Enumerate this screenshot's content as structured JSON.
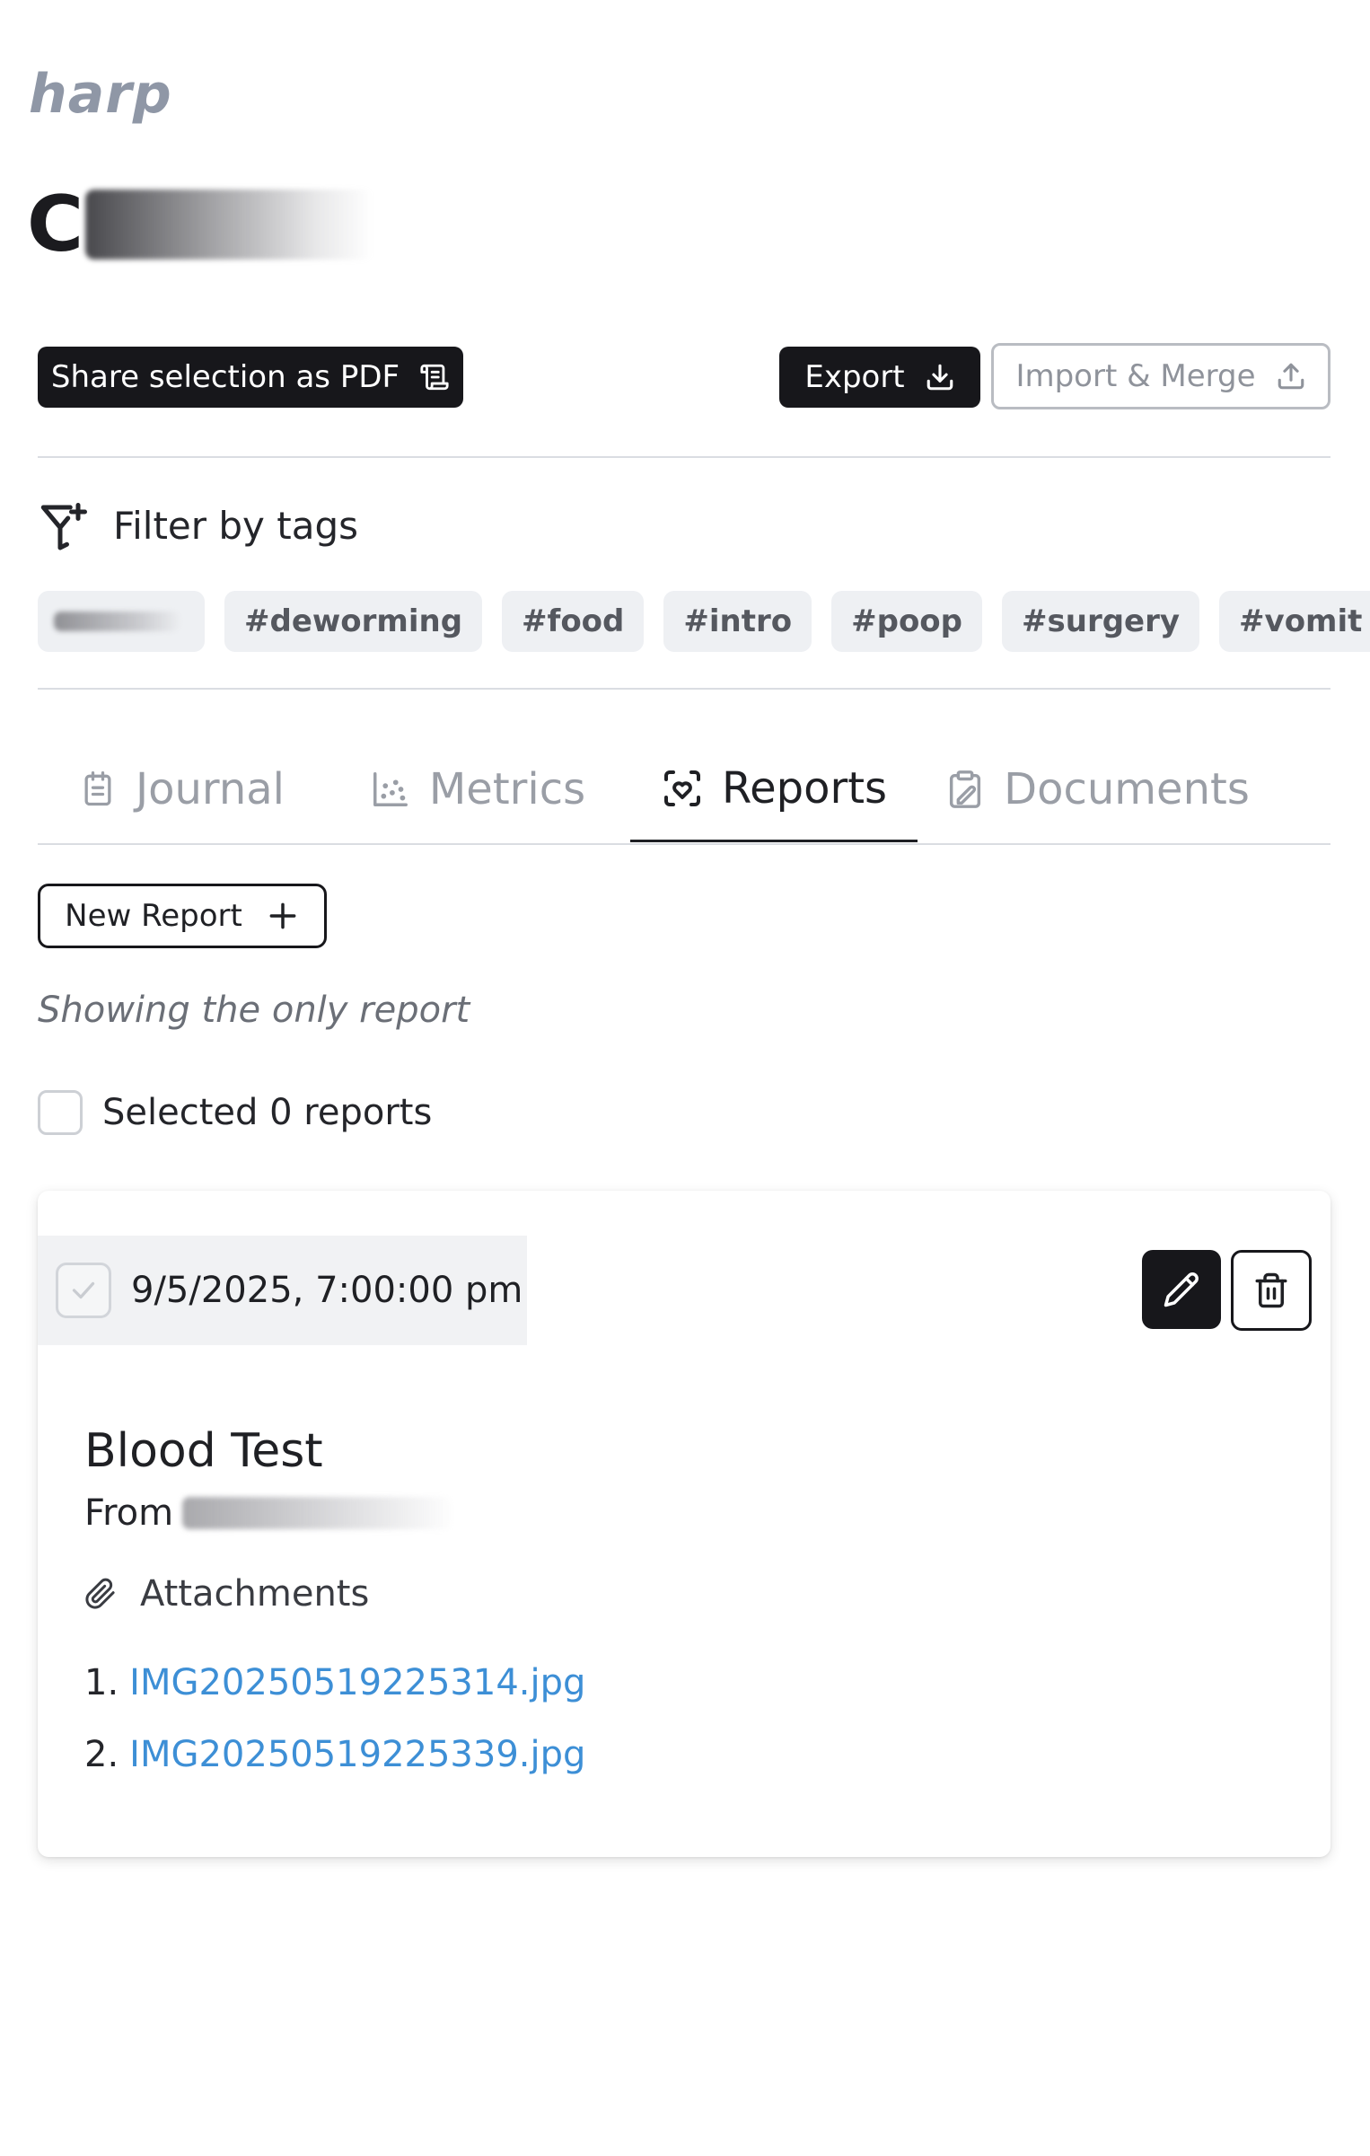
{
  "app": {
    "logo": "harp",
    "pet_name_initial": "C"
  },
  "toolbar": {
    "share_label": "Share selection as PDF",
    "export_label": "Export",
    "import_label": "Import & Merge"
  },
  "filter": {
    "label": "Filter by tags",
    "tags": [
      "#deworming",
      "#food",
      "#intro",
      "#poop",
      "#surgery",
      "#vomit"
    ]
  },
  "tabs": [
    {
      "label": "Journal",
      "icon": "journal-icon",
      "active": false
    },
    {
      "label": "Metrics",
      "icon": "metrics-icon",
      "active": false
    },
    {
      "label": "Reports",
      "icon": "reports-icon",
      "active": true
    },
    {
      "label": "Documents",
      "icon": "documents-icon",
      "active": false
    }
  ],
  "reports": {
    "new_label": "New Report",
    "showing_text": "Showing the only report",
    "selected_text": "Selected 0 reports",
    "items": [
      {
        "date": "9/5/2025, 7:00:00 pm",
        "title": "Blood Test",
        "from_label": "From",
        "attachments_label": "Attachments",
        "attachments": [
          {
            "index": "1.",
            "name": "IMG20250519225314.jpg"
          },
          {
            "index": "2.",
            "name": "IMG20250519225339.jpg"
          }
        ]
      }
    ]
  },
  "colors": {
    "primary": "#17171b",
    "link": "#3d8fd6",
    "muted": "#9a9ea6",
    "logo": "#8f97a6"
  }
}
